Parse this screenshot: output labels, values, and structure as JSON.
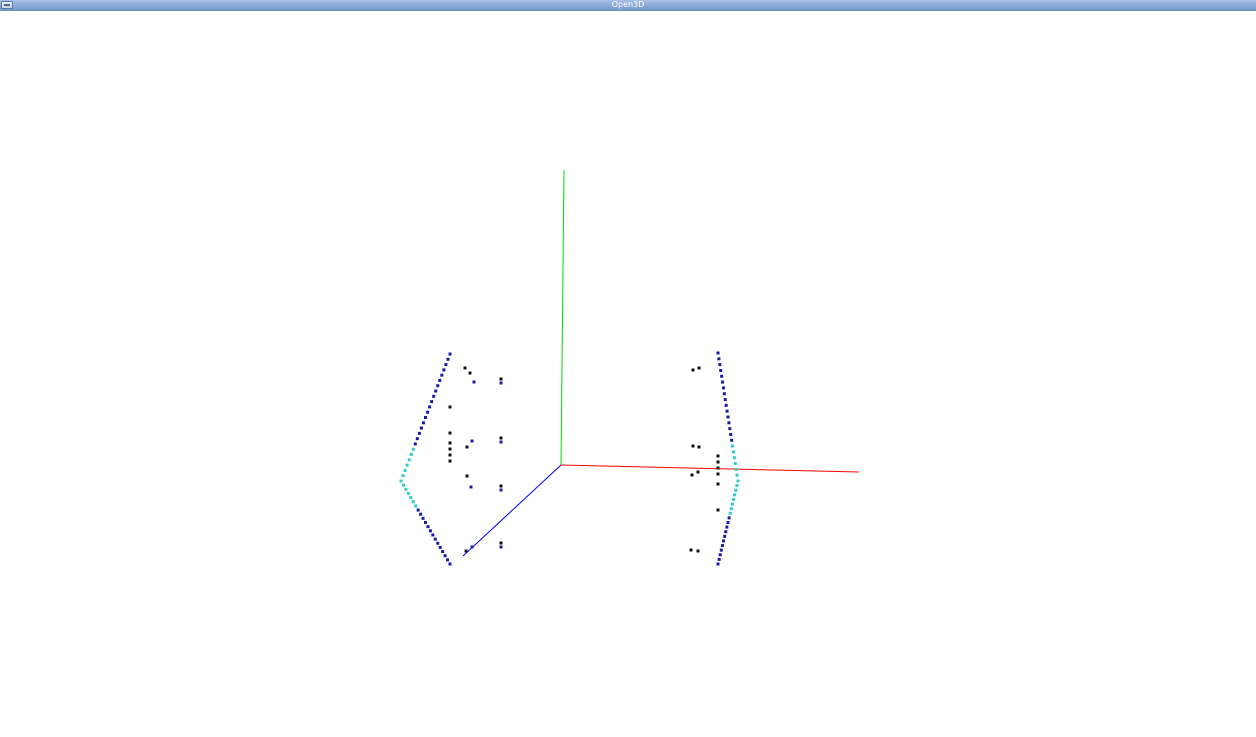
{
  "window": {
    "title": "Open3D"
  },
  "icons": {
    "menu": "window-menu-icon"
  },
  "colors": {
    "titlebar": "#8aa9d6",
    "background": "#ffffff",
    "x_axis": "#ff0000",
    "y_axis": "#00dd00",
    "z_axis": "#0000ff",
    "frustum_points": "#1a1aa8",
    "frustum_highlight": "#33cccc",
    "marker_points": "#111111"
  }
}
